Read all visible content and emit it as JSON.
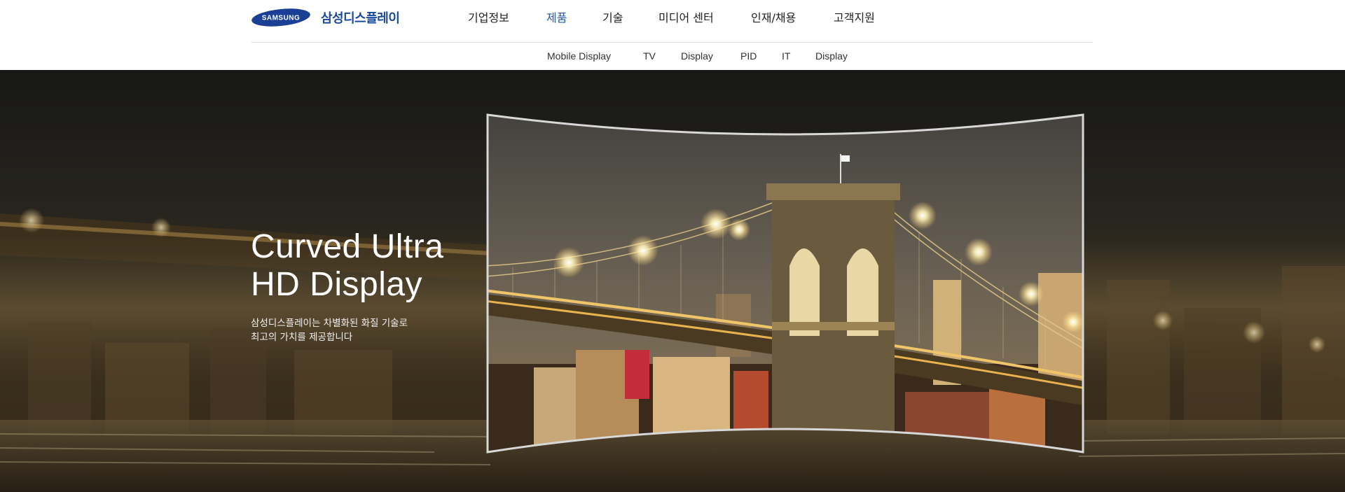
{
  "brand": {
    "logo_text": "SAMSUNG",
    "name": "삼성디스플레이"
  },
  "gnb": {
    "items": [
      {
        "label": "기업정보"
      },
      {
        "label": "제품",
        "active": true
      },
      {
        "label": "기술"
      },
      {
        "label": "미디어 센터"
      },
      {
        "label": "인재/채용"
      },
      {
        "label": "고객지원"
      }
    ]
  },
  "lnb": {
    "items": [
      {
        "label": "Mobile Display"
      },
      {
        "label": "TV"
      },
      {
        "label": "Display"
      },
      {
        "label": "PID"
      },
      {
        "label": "IT"
      },
      {
        "label": "Display"
      }
    ]
  },
  "hero": {
    "title_line1": "Curved Ultra",
    "title_line2": "HD Display",
    "desc_line1": "삼성디스플레이는 차별화된 화질 기술로",
    "desc_line2": "최고의 가치를 제공합니다",
    "background": "night-city-bridge-photo",
    "screen_image": "brooklyn-bridge-night-photo"
  },
  "colors": {
    "brand_blue": "#1a4a9c",
    "nav_active": "#2357a6",
    "nav_text": "#222222"
  }
}
